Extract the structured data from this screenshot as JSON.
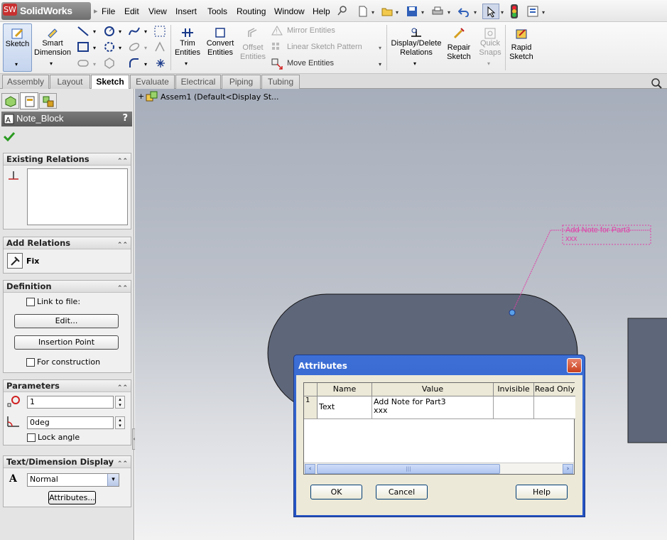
{
  "app": {
    "logo_text": "SolidWorks",
    "logo_mark": "SW"
  },
  "menu": [
    "File",
    "Edit",
    "View",
    "Insert",
    "Tools",
    "Routing",
    "Window",
    "Help"
  ],
  "commands": {
    "sketch": "Sketch",
    "smart_dimension": [
      "Smart",
      "Dimension"
    ],
    "trim_entities": [
      "Trim",
      "Entities"
    ],
    "convert_entities": [
      "Convert",
      "Entities"
    ],
    "offset_entities": [
      "Offset",
      "Entities"
    ],
    "mirror_entities": "Mirror Entities",
    "linear_sketch_pattern": "Linear Sketch Pattern",
    "move_entities": "Move Entities",
    "display_delete_relations": [
      "Display/Delete",
      "Relations"
    ],
    "repair_sketch": [
      "Repair",
      "Sketch"
    ],
    "quick_snaps": [
      "Quick",
      "Snaps"
    ],
    "rapid_sketch": [
      "Rapid",
      "Sketch"
    ]
  },
  "tabs": [
    "Assembly",
    "Layout",
    "Sketch",
    "Evaluate",
    "Electrical",
    "Piping",
    "Tubing"
  ],
  "active_tab": "Sketch",
  "property_manager": {
    "title": "Note_Block",
    "help": "?",
    "existing_relations": {
      "header": "Existing Relations"
    },
    "add_relations": {
      "header": "Add Relations",
      "fix_label": "Fix"
    },
    "definition": {
      "header": "Definition",
      "link_to_file": "Link to file:",
      "edit_button": "Edit...",
      "insertion_point_button": "Insertion Point",
      "for_construction": "For construction"
    },
    "parameters": {
      "header": "Parameters",
      "scale_value": "1",
      "angle_value": "0deg",
      "lock_angle": "Lock angle"
    },
    "text_display": {
      "header": "Text/Dimension Display",
      "font_style": "Normal",
      "attributes_button": "Attributes...",
      "font_glyph": "A"
    }
  },
  "tree": {
    "root": "Assem1  (Default<Display St..."
  },
  "note": {
    "line1": "Add Note for Part3",
    "line2": "xxx",
    "color": "#e040a8"
  },
  "dialog": {
    "title": "Attributes",
    "columns": [
      "Name",
      "Value",
      "Invisible",
      "Read Only"
    ],
    "rows": [
      {
        "index": "1",
        "name": "Text",
        "value_line1": "Add Note for Part3",
        "value_line2": "xxx",
        "invisible": "",
        "read_only": ""
      }
    ],
    "ok": "OK",
    "cancel": "Cancel",
    "help": "Help"
  },
  "colors": {
    "accent": "#3a6fd8",
    "viewport_top": "#a7aebb",
    "part_fill": "#626a7d",
    "note_pink": "#e040a8"
  }
}
